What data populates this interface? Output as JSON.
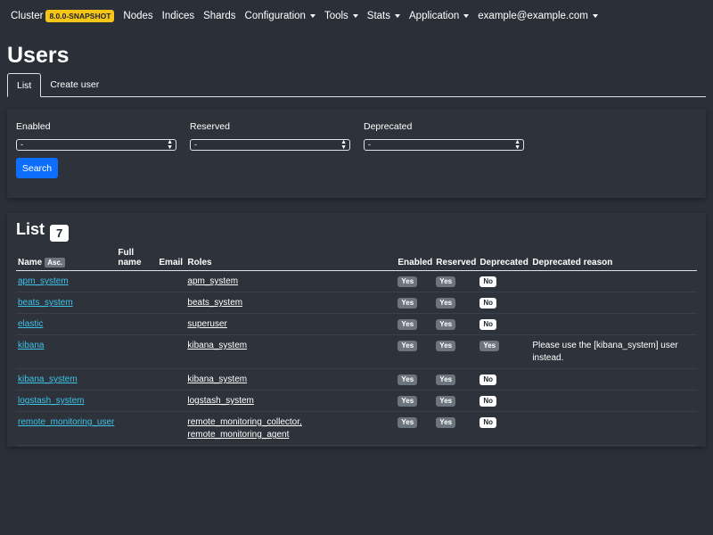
{
  "navbar": {
    "brand": "Cluster",
    "version": "8.0.0-SNAPSHOT",
    "items": [
      {
        "label": "Nodes",
        "dropdown": false
      },
      {
        "label": "Indices",
        "dropdown": false
      },
      {
        "label": "Shards",
        "dropdown": false
      },
      {
        "label": "Configuration",
        "dropdown": true
      },
      {
        "label": "Tools",
        "dropdown": true
      },
      {
        "label": "Stats",
        "dropdown": true
      },
      {
        "label": "Application",
        "dropdown": true
      },
      {
        "label": "example@example.com",
        "dropdown": true
      }
    ]
  },
  "page": {
    "title": "Users"
  },
  "tabs": [
    {
      "label": "List",
      "active": true
    },
    {
      "label": "Create user",
      "active": false
    }
  ],
  "filters": {
    "enabled": {
      "label": "Enabled",
      "value": "-"
    },
    "reserved": {
      "label": "Reserved",
      "value": "-"
    },
    "deprecated": {
      "label": "Deprecated",
      "value": "-"
    },
    "search_label": "Search"
  },
  "list": {
    "title": "List",
    "count": "7",
    "columns": {
      "name": "Name",
      "sort": "Asc.",
      "full_name": "Full name",
      "email": "Email",
      "roles": "Roles",
      "enabled": "Enabled",
      "reserved": "Reserved",
      "deprecated": "Deprecated",
      "deprecated_reason": "Deprecated reason"
    },
    "rows": [
      {
        "name": "apm_system",
        "roles": [
          "apm_system"
        ],
        "enabled": "Yes",
        "reserved": "Yes",
        "deprecated": "No",
        "reason": ""
      },
      {
        "name": "beats_system",
        "roles": [
          "beats_system"
        ],
        "enabled": "Yes",
        "reserved": "Yes",
        "deprecated": "No",
        "reason": ""
      },
      {
        "name": "elastic",
        "roles": [
          "superuser"
        ],
        "enabled": "Yes",
        "reserved": "Yes",
        "deprecated": "No",
        "reason": ""
      },
      {
        "name": "kibana",
        "roles": [
          "kibana_system"
        ],
        "enabled": "Yes",
        "reserved": "Yes",
        "deprecated": "Yes",
        "reason": "Please use the [kibana_system] user instead."
      },
      {
        "name": "kibana_system",
        "roles": [
          "kibana_system"
        ],
        "enabled": "Yes",
        "reserved": "Yes",
        "deprecated": "No",
        "reason": ""
      },
      {
        "name": "logstash_system",
        "roles": [
          "logstash_system"
        ],
        "enabled": "Yes",
        "reserved": "Yes",
        "deprecated": "No",
        "reason": ""
      },
      {
        "name": "remote_monitoring_user",
        "roles": [
          "remote_monitoring_collector,",
          "remote_monitoring_agent"
        ],
        "enabled": "Yes",
        "reserved": "Yes",
        "deprecated": "No",
        "reason": ""
      }
    ]
  },
  "colors": {
    "background": "#2b3038",
    "card": "#2e333b",
    "accent": "#0d6efd",
    "link": "#3ec3e8",
    "version_badge": "#f5c518",
    "pill_gray": "#6c757d"
  },
  "icons": {
    "dropdown": "caret-down-icon",
    "select": "select-arrows-icon"
  }
}
